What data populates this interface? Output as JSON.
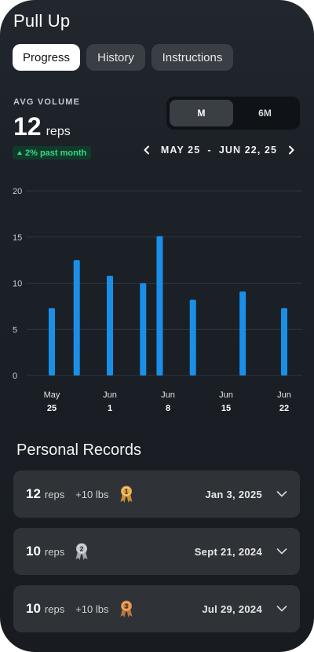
{
  "header": {
    "title": "Pull Up"
  },
  "tabs": [
    {
      "label": "Progress",
      "active": true
    },
    {
      "label": "History",
      "active": false
    },
    {
      "label": "Instructions",
      "active": false
    }
  ],
  "summary": {
    "label": "AVG VOLUME",
    "value": "12",
    "unit": "reps",
    "trend": "2% past month",
    "trend_color": "#37d68a"
  },
  "period_toggle": {
    "options": [
      "M",
      "6M"
    ],
    "selected": "M"
  },
  "date_range": {
    "text": "MAY 25  -  JUN 22, 25"
  },
  "chart_data": {
    "type": "bar",
    "ylim": [
      0,
      20
    ],
    "yticks": [
      0,
      5,
      10,
      15,
      20
    ],
    "x_range": [
      0,
      28
    ],
    "x_ticks": [
      {
        "day": 0,
        "month": "May",
        "date": "25"
      },
      {
        "day": 7,
        "month": "Jun",
        "date": "1"
      },
      {
        "day": 14,
        "month": "Jun",
        "date": "8"
      },
      {
        "day": 21,
        "month": "Jun",
        "date": "15"
      },
      {
        "day": 28,
        "month": "Jun",
        "date": "22"
      }
    ],
    "bars": [
      {
        "day": 0,
        "value": 7.3
      },
      {
        "day": 3,
        "value": 12.5
      },
      {
        "day": 7,
        "value": 10.8
      },
      {
        "day": 11,
        "value": 10
      },
      {
        "day": 13,
        "value": 15.1
      },
      {
        "day": 17,
        "value": 8.2
      },
      {
        "day": 23,
        "value": 9.1
      },
      {
        "day": 28,
        "value": 7.3
      }
    ],
    "bar_color": "#1a8fe8",
    "grid": true
  },
  "personal_records": {
    "title": "Personal Records",
    "items": [
      {
        "reps": "12",
        "reps_unit": "reps",
        "extra": "+10 lbs",
        "rank": "1",
        "medal_icon": "gold-medal-icon",
        "medal_color": "#e0a238",
        "date": "Jan 3, 2025"
      },
      {
        "reps": "10",
        "reps_unit": "reps",
        "extra": "",
        "rank": "2",
        "medal_icon": "silver-medal-icon",
        "medal_color": "#b9c0c8",
        "date": "Sept 21, 2024"
      },
      {
        "reps": "10",
        "reps_unit": "reps",
        "extra": "+10 lbs",
        "rank": "3",
        "medal_icon": "bronze-medal-icon",
        "medal_color": "#d2813a",
        "date": "Jul 29, 2024"
      }
    ]
  }
}
